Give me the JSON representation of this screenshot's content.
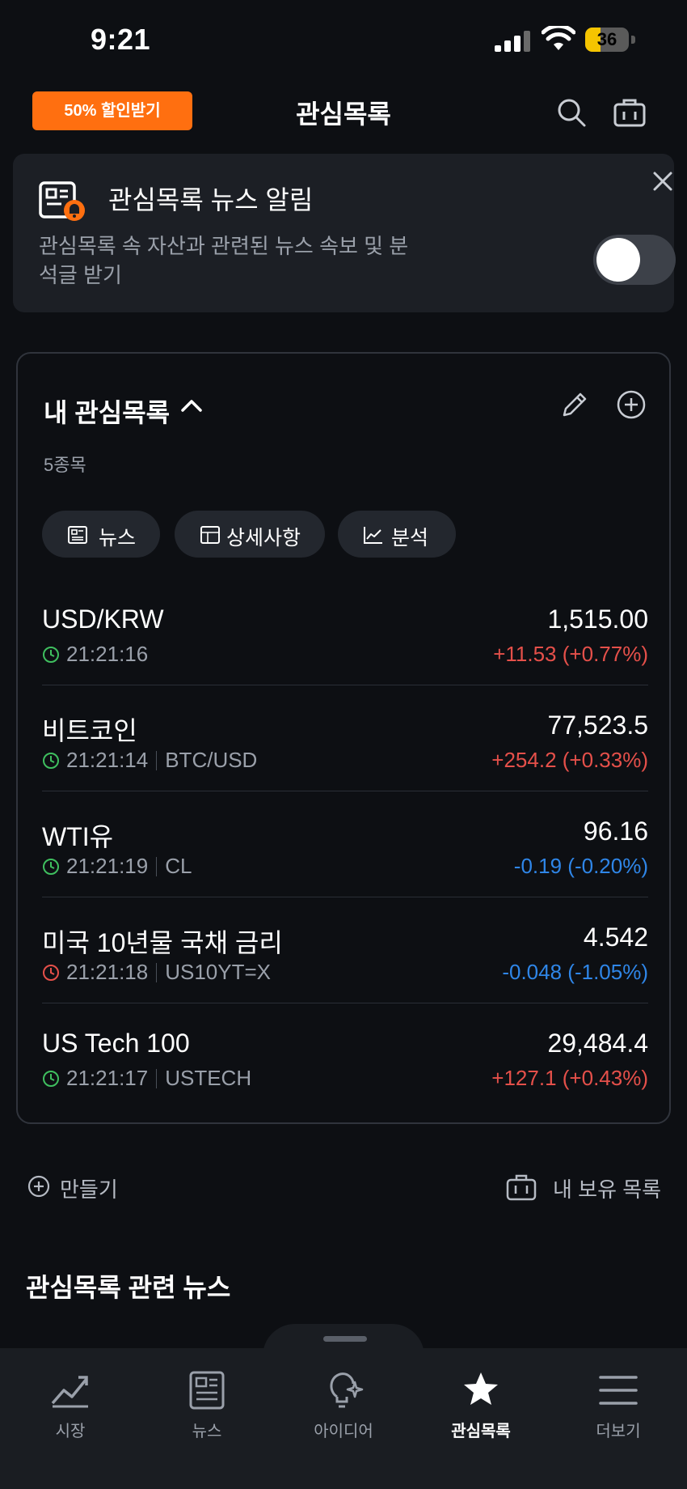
{
  "status": {
    "time": "9:21",
    "battery": "36",
    "battery_level": 0.36
  },
  "header": {
    "promo_label": "50% 할인받기",
    "title": "관심목록"
  },
  "alert": {
    "title": "관심목록 뉴스 알림",
    "description": "관심목록 속 자산과 관련된 뉴스 속보 및 분석글 받기",
    "toggle_on": false
  },
  "watchlist": {
    "title": "내 관심목록",
    "count": "5종목",
    "chips": [
      {
        "label": "뉴스",
        "icon": "newspaper-icon"
      },
      {
        "label": "상세사항",
        "icon": "table-icon"
      },
      {
        "label": "분석",
        "icon": "chart-line-icon"
      }
    ],
    "rows": [
      {
        "name": "USD/KRW",
        "time": "21:21:16",
        "symbol": "",
        "price": "1,515.00",
        "change": "+11.53",
        "change_pct": "(+0.77%)",
        "direction": "up",
        "clock_color": "#3fbf5f"
      },
      {
        "name": "비트코인",
        "time": "21:21:14",
        "symbol": "BTC/USD",
        "price": "77,523.5",
        "change": "+254.2",
        "change_pct": "(+0.33%)",
        "direction": "up",
        "clock_color": "#3fbf5f"
      },
      {
        "name": "WTI유",
        "time": "21:21:19",
        "symbol": "CL",
        "price": "96.16",
        "change": "-0.19",
        "change_pct": "(-0.20%)",
        "direction": "down",
        "clock_color": "#3fbf5f"
      },
      {
        "name": "미국 10년물 국채 금리",
        "time": "21:21:18",
        "symbol": "US10YT=X",
        "price": "4.542",
        "change": "-0.048",
        "change_pct": "(-1.05%)",
        "direction": "down",
        "clock_color": "#e5504a"
      },
      {
        "name": "US Tech 100",
        "time": "21:21:17",
        "symbol": "USTECH",
        "price": "29,484.4",
        "change": "+127.1",
        "change_pct": "(+0.43%)",
        "direction": "up",
        "clock_color": "#3fbf5f"
      }
    ]
  },
  "actions": {
    "create_label": "만들기",
    "holdings_label": "내 보유 목록"
  },
  "news_section": {
    "title": "관심목록 관련 뉴스"
  },
  "tabs": [
    {
      "label": "시장",
      "icon": "market-chart-icon",
      "active": false
    },
    {
      "label": "뉴스",
      "icon": "newspaper-icon",
      "active": false
    },
    {
      "label": "아이디어",
      "icon": "lightbulb-icon",
      "active": false
    },
    {
      "label": "관심목록",
      "icon": "star-icon",
      "active": true
    },
    {
      "label": "더보기",
      "icon": "menu-icon",
      "active": false
    }
  ],
  "colors": {
    "accent": "#ff6f10",
    "up": "#e5504a",
    "down": "#2f86e8",
    "background": "#0d0f13"
  }
}
